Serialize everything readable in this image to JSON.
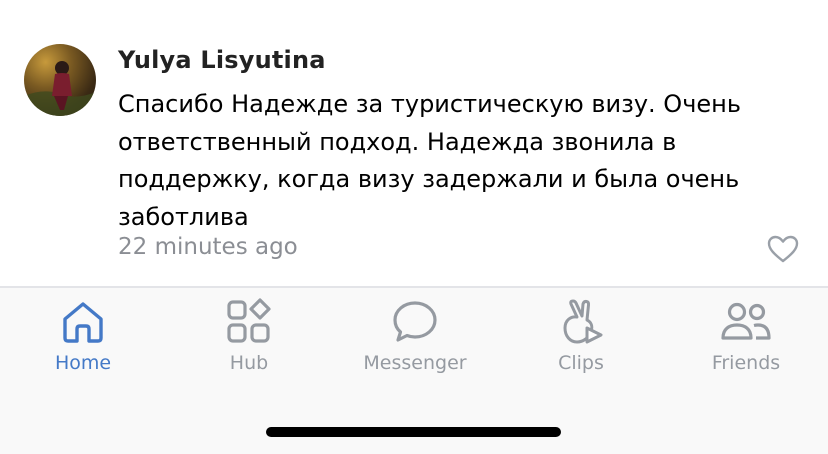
{
  "comment": {
    "author": "Yulya Lisyutina",
    "text": "Спасибо Надежде за туристическую визу. Очень ответственный подход. Надежда звонила в поддержку, когда визу задержали и была очень заботлива",
    "timestamp": "22 minutes ago",
    "like_icon": "heart-icon"
  },
  "tabbar": {
    "active": "Home",
    "tabs": [
      {
        "label": "Home",
        "icon": "home-icon"
      },
      {
        "label": "Hub",
        "icon": "hub-grid-icon"
      },
      {
        "label": "Messenger",
        "icon": "speech-bubble-icon"
      },
      {
        "label": "Clips",
        "icon": "clips-icon"
      },
      {
        "label": "Friends",
        "icon": "friends-icon"
      }
    ]
  },
  "colors": {
    "accent": "#4479c7",
    "inactive": "#959aa1",
    "timestamp": "#8b8e94"
  }
}
